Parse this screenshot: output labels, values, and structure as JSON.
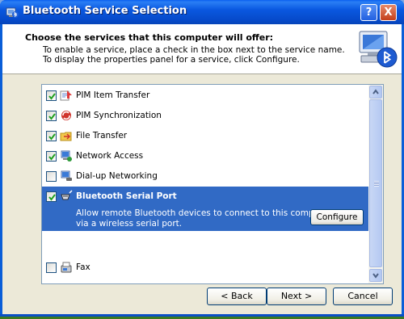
{
  "window": {
    "title": "Bluetooth Service Selection",
    "help_label": "?",
    "close_label": "X"
  },
  "header": {
    "heading": "Choose the services that this computer will offer:",
    "line1": "To enable a service, place a check in the box next to the service name.",
    "line2": "To display the properties panel for a service, click Configure."
  },
  "services": [
    {
      "label": "PIM Item Transfer",
      "checked": true,
      "icon": "pim-transfer-icon"
    },
    {
      "label": "PIM Synchronization",
      "checked": true,
      "icon": "pim-sync-icon"
    },
    {
      "label": "File Transfer",
      "checked": true,
      "icon": "file-transfer-icon"
    },
    {
      "label": "Network Access",
      "checked": true,
      "icon": "network-access-icon"
    },
    {
      "label": "Dial-up Networking",
      "checked": false,
      "icon": "dialup-icon"
    },
    {
      "label": "Bluetooth Serial Port",
      "checked": true,
      "icon": "serial-port-icon",
      "description_line1": "Allow remote Bluetooth devices to connect to this computer",
      "description_line2": "via a wireless serial port.",
      "configure_label": "Configure"
    },
    {
      "label": "Fax",
      "checked": false,
      "icon": "fax-icon"
    }
  ],
  "buttons": {
    "back": "< Back",
    "next": "Next >",
    "cancel": "Cancel"
  },
  "colors": {
    "titlebar": "#0a58e0",
    "selection": "#316ac5",
    "dialog_bg": "#ece9d8"
  }
}
